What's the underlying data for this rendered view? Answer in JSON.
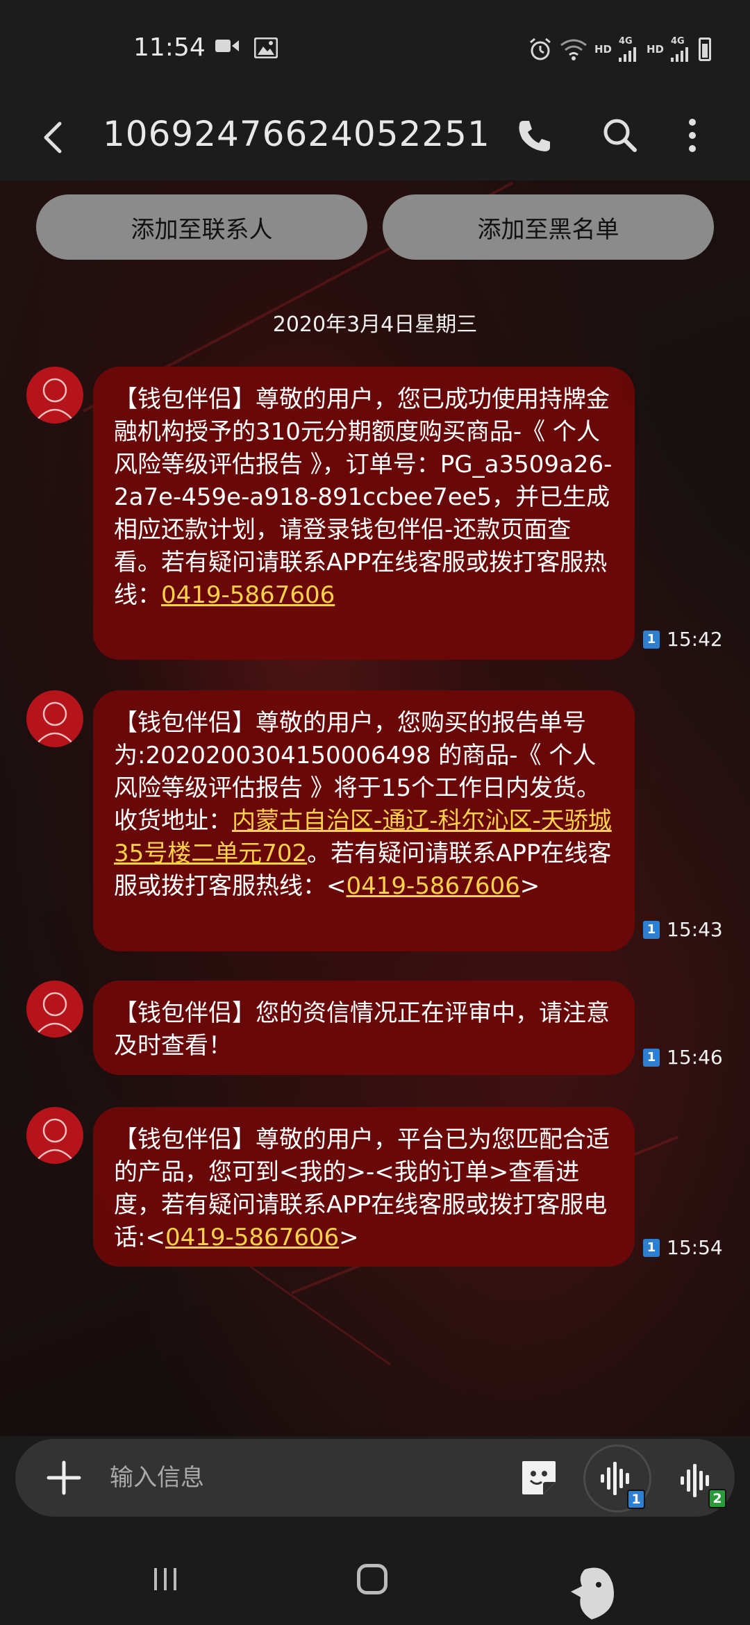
{
  "status_bar": {
    "time": "11:54",
    "left_icons": [
      "video-icon",
      "image-icon"
    ],
    "right_icons": [
      "alarm-icon",
      "wifi-icon",
      "hd-icon",
      "signal-4g-icon",
      "hd-icon",
      "signal-4g-icon",
      "battery-icon"
    ],
    "hd_label": "HD",
    "network_label": "4G"
  },
  "app_bar": {
    "title": "10692476624052251",
    "icons": [
      "back-icon",
      "phone-icon",
      "search-icon",
      "more-icon"
    ]
  },
  "actions": {
    "add_contact": "添加至联系人",
    "add_blacklist": "添加至黑名单"
  },
  "date_header": "2020年3月4日星期三",
  "messages": [
    {
      "text_before": "【钱包伴侣】尊敬的用户，您已成功使用持牌金融机构授予的310元分期额度购买商品-《 个人风险等级评估报告 》，订单号：PG_a3509a26-2a7e-459e-a918-891ccbee7ee5，并已生成相应还款计划，请登录钱包伴侣-还款页面查看。若有疑问请联系APP在线客服或拨打客服热线：",
      "link": "0419-5867606",
      "text_after": "",
      "sim": "1",
      "time": "15:42"
    },
    {
      "text_before": "【钱包伴侣】尊敬的用户，您购买的报告单号为:202020030415000​6498 的商品-《 个人风险等级评估报告 》将于15个工作日内发货。收货地址：",
      "link_address": "内蒙古自治区-通辽-科尔沁区-天骄城35号楼二单元702",
      "text_middle": "。若有疑问请联系APP在线客服或拨打客服热线：<",
      "link": "0419-5867606",
      "text_after": ">",
      "sim": "1",
      "time": "15:43"
    },
    {
      "text_before": "【钱包伴侣】您的资信情况正在评审中，请注意及时查看！",
      "sim": "1",
      "time": "15:46"
    },
    {
      "text_before": "【钱包伴侣】尊敬的用户，平台已为您匹配合适的产品，您可到<我的>-<我的订单>查看进度，若有疑问请联系APP在线客服或拨打客服电话:<",
      "link": "0419-5867606",
      "text_after": ">",
      "sim": "1",
      "time": "15:54"
    }
  ],
  "composer": {
    "placeholder": "输入信息",
    "voice_sim1": "1",
    "voice_sim2": "2",
    "colors": {
      "sim1": "#2e7fd0",
      "sim2": "#2a9a3a"
    }
  },
  "nav_bar": {
    "icons": [
      "recents-icon",
      "home-icon",
      "back-gesture-icon"
    ]
  }
}
